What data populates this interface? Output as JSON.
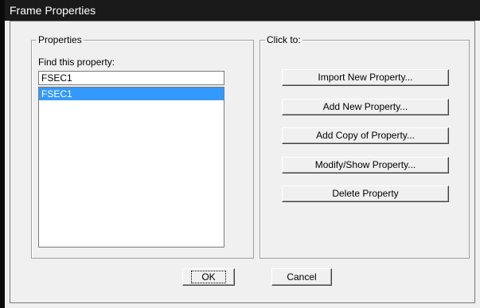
{
  "window": {
    "title": "Frame Properties"
  },
  "properties": {
    "group_label": "Properties",
    "find_label": "Find this property:",
    "find_value": "FSEC1",
    "items": [
      {
        "label": "FSEC1",
        "selected": true
      }
    ]
  },
  "click_to": {
    "group_label": "Click to:",
    "buttons": {
      "import": "Import New Property...",
      "add": "Add New Property...",
      "add_copy": "Add Copy of Property...",
      "modify": "Modify/Show Property...",
      "delete": "Delete Property"
    }
  },
  "footer": {
    "ok": "OK",
    "cancel": "Cancel"
  },
  "colors": {
    "selection": "#3399ff",
    "titlebar": "#1a1a1a"
  }
}
